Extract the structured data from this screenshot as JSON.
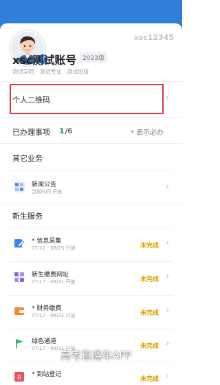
{
  "profile": {
    "student_id": "xsc12345",
    "name": "xsc测试账号",
    "grade": "2023级",
    "school_line": "测试学院 · 测试专业 · 测试班级",
    "gender_symbol": "♂"
  },
  "qr": {
    "label": "个人二维码"
  },
  "done": {
    "label": "已办理事项",
    "count_done": "1",
    "count_total": "/6",
    "note": "* 表示必办"
  },
  "other": {
    "title": "其它业务",
    "items": [
      {
        "title": "新闻公告",
        "sub": "当前时间 开放",
        "icon": "news-icon",
        "color": "#5b8def"
      }
    ]
  },
  "freshman": {
    "title": "新生服务",
    "items": [
      {
        "title": "* 信息采集",
        "sub": "07/12 - 08/25 开放",
        "status": "未完成",
        "icon": "edit-icon",
        "color": "#3a86e8"
      },
      {
        "title": "新生缴费网址",
        "sub": "07/17 - 08/31 开放",
        "status": "未完成",
        "icon": "grid-icon",
        "color": "#7a6ee6"
      },
      {
        "title": "* 财务缴费",
        "sub": "07/17 - 08/31 开放",
        "status": "未完成",
        "icon": "wallet-icon",
        "color": "#f08a34"
      },
      {
        "title": "绿色通道",
        "sub": "07/17 - 08/31 开放",
        "status": "未完成",
        "icon": "flag-icon",
        "color": "#2fb36b"
      },
      {
        "title": "* 到站登记",
        "sub": "",
        "status": "未完成",
        "icon": "register-icon",
        "color": "#e8505b"
      }
    ]
  },
  "chevron": "›",
  "watermark": "高考直通车APP"
}
